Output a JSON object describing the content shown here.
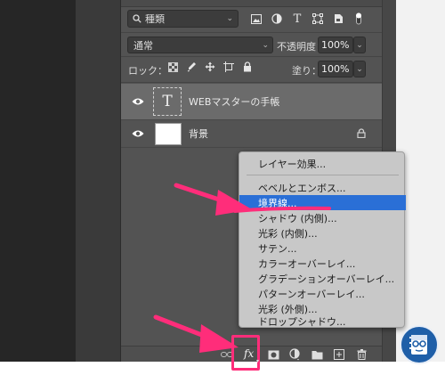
{
  "layers_panel": {
    "filter": {
      "value": "種類",
      "icons": [
        "image-filter-icon",
        "adjustment-filter-icon",
        "type-filter-icon",
        "shape-filter-icon",
        "smart-object-filter-icon",
        "filter-toggle-icon"
      ]
    },
    "blend_mode": {
      "value": "通常"
    },
    "opacity": {
      "label": "不透明度：",
      "value": "100%"
    },
    "lock": {
      "label": "ロック：",
      "icons": [
        "lock-transparent-icon",
        "lock-image-icon",
        "lock-position-icon",
        "lock-artboard-icon",
        "lock-all-icon"
      ]
    },
    "fill": {
      "label": "塗り：",
      "value": "100%"
    },
    "layers": [
      {
        "name": "WEBマスターの手帳",
        "thumb_glyph": "T",
        "selected": true
      },
      {
        "name": "背景",
        "locked": true
      }
    ],
    "bottom_toolbar": {
      "fx_label": "fx"
    }
  },
  "fx_menu": {
    "items": [
      "レイヤー効果...",
      "ベベルとエンボス...",
      "境界線...",
      "シャドウ (内側)...",
      "光彩 (内側)...",
      "サテン...",
      "カラーオーバーレイ...",
      "グラデーションオーバーレイ...",
      "パターンオーバーレイ...",
      "光彩 (外側)...",
      "ドロップシャドウ..."
    ],
    "selected_index": 2
  },
  "colors": {
    "accent_arrow": "#ff2d7a",
    "menu_highlight": "#2a6fd6",
    "panel_bg": "#535353"
  }
}
